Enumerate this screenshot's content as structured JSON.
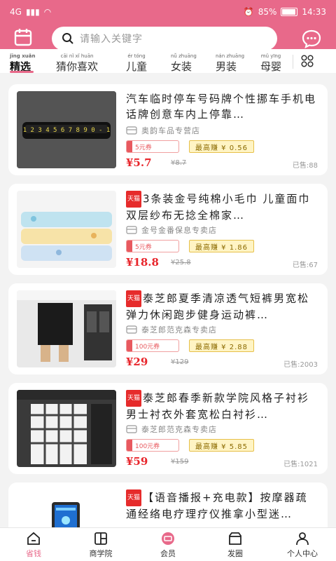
{
  "status": {
    "network": "4G",
    "battery": "85%",
    "battery_level": 0.85,
    "time": "14:33"
  },
  "search": {
    "placeholder": "请输入关键字"
  },
  "tabs": [
    {
      "label": "精选",
      "pinyin": "jīng xuǎn",
      "active": true
    },
    {
      "label": "猜你喜欢",
      "pinyin": "cāi nǐ xǐ huān",
      "active": false
    },
    {
      "label": "儿童",
      "pinyin": "ér tóng",
      "active": false
    },
    {
      "label": "女装",
      "pinyin": "nǚ zhuāng",
      "active": false
    },
    {
      "label": "男装",
      "pinyin": "nán zhuāng",
      "active": false
    },
    {
      "label": "母婴",
      "pinyin": "mǔ yīng",
      "active": false
    }
  ],
  "products": [
    {
      "tmall": false,
      "title": "汽车临时停车号码牌个性挪车手机电话牌创意车内上停靠…",
      "shop": "奥韵车品专营店",
      "coupon": "5元券",
      "earn": "最高赚 ¥ 0.56",
      "price": "¥5.7",
      "orig_price": "¥8.7",
      "sold": "已售:88"
    },
    {
      "tmall": true,
      "title": "3条装金号纯棉小毛巾 儿童面巾双层纱布无捻全棉家…",
      "shop": "金号金番保息专卖店",
      "coupon": "5元券",
      "earn": "最高赚 ¥ 1.86",
      "price": "¥18.8",
      "orig_price": "¥25.8",
      "sold": "已售:67"
    },
    {
      "tmall": true,
      "title": "泰芝郎夏季清凉透气短裤男宽松弹力休闲跑步健身运动裤…",
      "shop": "泰芝郎范克森专卖店",
      "coupon": "100元券",
      "earn": "最高赚 ¥ 2.88",
      "price": "¥29",
      "orig_price": "¥129",
      "sold": "已售:2003"
    },
    {
      "tmall": true,
      "title": "泰芝郎春季新款学院风格子衬衫男士衬衣外套宽松白衬衫…",
      "shop": "泰芝郎范克森专卖店",
      "coupon": "100元券",
      "earn": "最高赚 ¥ 5.85",
      "price": "¥59",
      "orig_price": "¥159",
      "sold": "已售:1021"
    },
    {
      "tmall": true,
      "title": "【语音播报+充电款】按摩器疏通经络电疗理疗仪推拿小型迷…",
      "shop": "",
      "coupon": "",
      "earn": "",
      "price": "",
      "orig_price": "",
      "sold": ""
    }
  ],
  "nav": [
    {
      "label": "省钱",
      "icon": "home-icon",
      "active": true
    },
    {
      "label": "商学院",
      "icon": "school-icon",
      "active": false
    },
    {
      "label": "会员",
      "icon": "member-icon",
      "active": false
    },
    {
      "label": "发圈",
      "icon": "share-circle-icon",
      "active": false
    },
    {
      "label": "个人中心",
      "icon": "user-icon",
      "active": false
    }
  ],
  "colors": {
    "brand": "#e8698a",
    "price": "#e8252b",
    "coupon": "#e8595f",
    "earn_bg": "#fff4c4"
  }
}
